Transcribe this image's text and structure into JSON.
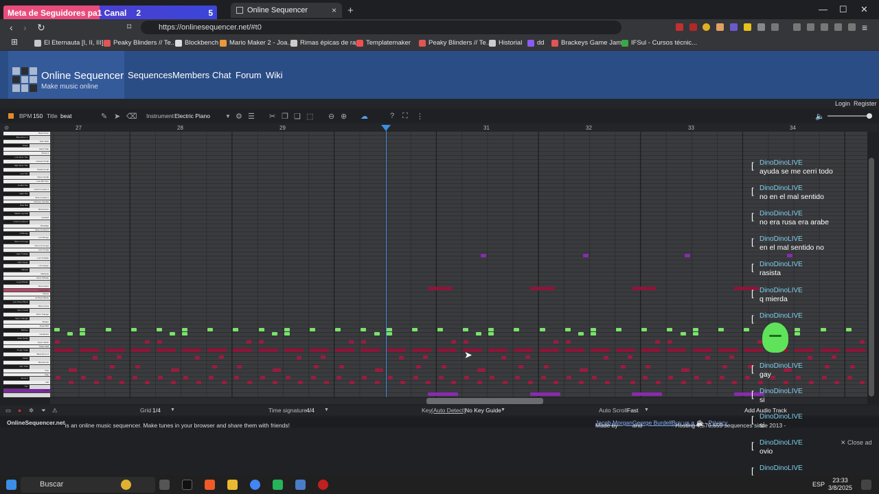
{
  "overlay_goal": {
    "title": "Meta de Seguidores pa1 Canal",
    "current": "2",
    "target": "5"
  },
  "tab": {
    "title": "Online Sequencer",
    "close": "×",
    "new_tab": "+"
  },
  "window_controls": {
    "minimize": "—",
    "maximize": "☐",
    "close": "✕"
  },
  "address": {
    "url": "https://onlinesequencer.net/#t0"
  },
  "bookmarks": [
    {
      "label": "El Eternauta [I, II, III],...",
      "color": "#c8c8c8"
    },
    {
      "label": "Peaky Blinders // Te...",
      "color": "#e05555"
    },
    {
      "label": "Blockbench",
      "color": "#dddddd"
    },
    {
      "label": "Mario Maker 2 - Joa...",
      "color": "#e89a3c"
    },
    {
      "label": "Rimas épicas de rap",
      "color": "#cccccc"
    },
    {
      "label": "Templatemaker",
      "color": "#f05050"
    },
    {
      "label": "Peaky Blinders // Te...",
      "color": "#e05555"
    },
    {
      "label": "Historial",
      "color": "#cccccc"
    },
    {
      "label": "dd",
      "color": "#8a5cf5"
    },
    {
      "label": "Brackeys Game Jam...",
      "color": "#e05555"
    },
    {
      "label": "IFSul - Cursos técnic...",
      "color": "#3aa845"
    }
  ],
  "site": {
    "name": "Online Sequencer",
    "tagline": "Make music online",
    "nav": [
      "Sequences",
      "Members",
      "Chat",
      "Forum",
      "Wiki"
    ],
    "login": "Login",
    "register": "Register"
  },
  "toolbar": {
    "bpm_label": "BPM",
    "bpm": "150",
    "title_label": "Title",
    "title": "beat",
    "instrument_label": "Instrument",
    "instrument": "Electric Piano"
  },
  "ruler": [
    "27",
    "28",
    "29",
    "30",
    "31",
    "32",
    "33",
    "34"
  ],
  "piano_keys": [
    "Bass Drum",
    "Bass Drum 1",
    "Side Stick",
    "Snare",
    "Hand Clap",
    "Snare 2",
    "Low Floor Tom",
    "Closed Hi Hat",
    "High Floor Tom",
    "Pedal Hi-Hat",
    "Low Tom",
    "Open Hi-Hat",
    "Low-Mid Tom",
    "Hi-Mid Tom",
    "Crash Cymbal 1",
    "High Tom",
    "Ride Cymbal 1",
    "Chinese Cymbal",
    "Ride Bell",
    "Tambourine",
    "Splash Cymbal",
    "Cowbell",
    "Crash Cymbal 2",
    "Vibraslap",
    "Ride Cymbal 2",
    "Hi Bongo",
    "Low Bongo",
    "Mute Hi Conga",
    "Open Hi Conga",
    "Low Conga",
    "High Timbale",
    "Low Timbale",
    "High Agogo",
    "Low Agogo",
    "Cabasa",
    "Maracas",
    "Short Whistle",
    "Long Whistle",
    "Short Guiro",
    "Long Guiro",
    "Claves",
    "Hi Wood Block",
    "Low Wood Block",
    "Mute Cuica",
    "Open Cuica",
    "Mute Triangle",
    "Open Triangle",
    "Shaker",
    "Jingle Bell",
    "Belltree",
    "Castanets",
    "Mute Surdo",
    "Open Surdo",
    "Snare Roll",
    "Finger Snap",
    "Bass Drum 2",
    "Sticks",
    "Metronome",
    "Rim Shot",
    "Kick",
    "Clap",
    "Snare 3",
    "Hat",
    "Tom",
    "Crash"
  ],
  "bottombar": {
    "grid_label": "Grid",
    "grid": "1/4",
    "time_sig_label": "Time signature",
    "time_sig": "4/4",
    "key_label": "Key",
    "key_detect": "(Auto Detect)",
    "key": "No Key Guide",
    "autoscroll_label": "Auto Scroll",
    "autoscroll": "Fast",
    "add_audio": "Add Audio Track"
  },
  "info": {
    "site_bold": "OnlineSequencer.net",
    "desc": " is an online music sequencer. Make tunes in your browser and share them with friends!",
    "made_by": "Made by ",
    "author1": "Jacob Morgan",
    "and": " and ",
    "author2": "George Burdell",
    "hosting": " - Hosting 4,570,659 sequences since 2013 - ",
    "buy": "Buy us a ☕",
    "privacy": "Privacy"
  },
  "chat": [
    {
      "user": "DinoDinoLIVE",
      "msg": "ayuda se me cerri todo"
    },
    {
      "user": "DinoDinoLIVE",
      "msg": "no en el mal sentido"
    },
    {
      "user": "DinoDinoLIVE",
      "msg": "no era rusa era arabe"
    },
    {
      "user": "DinoDinoLIVE",
      "msg": "en el mal sentido no"
    },
    {
      "user": "DinoDinoLIVE",
      "msg": "rasista"
    },
    {
      "user": "DinoDinoLIVE",
      "msg": "q mierda"
    },
    {
      "user": "DinoDinoLIVE",
      "msg": ""
    },
    {
      "user": "DinoDinoLIVE",
      "msg": "gay"
    },
    {
      "user": "DinoDinoLIVE",
      "msg": "si"
    },
    {
      "user": "DinoDinoLIVE",
      "msg": "si"
    },
    {
      "user": "DinoDinoLIVE",
      "msg": "ovio"
    },
    {
      "user": "DinoDinoLIVE",
      "msg": ""
    }
  ],
  "close_ad": "✕ Close ad",
  "taskbar": {
    "search": "Buscar",
    "lang": "ESP",
    "time": "23:33",
    "date": "3/8/2025"
  },
  "colors": {
    "note_green": "#7be36b",
    "note_red": "#8e1538",
    "note_crimson": "#9b1c3e",
    "note_purple": "#8a2ab0",
    "header": "#2b4d86"
  }
}
